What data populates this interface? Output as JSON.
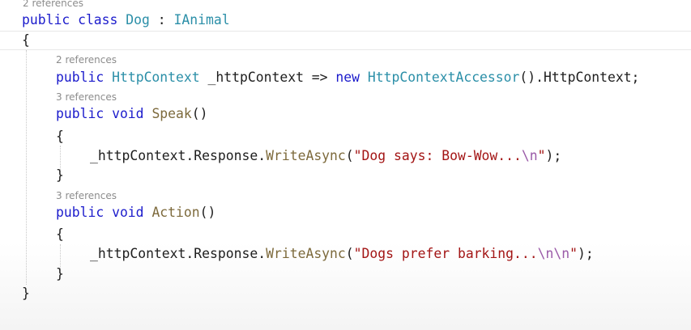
{
  "editor": {
    "refs": {
      "class": "2 references",
      "field": "2 references",
      "speak": "3 references",
      "action": "3 references"
    },
    "line1": {
      "kw": "public class",
      "name": "Dog",
      "sep": " : ",
      "iface": "IAnimal"
    },
    "line2": {
      "text": "{"
    },
    "line3": {
      "kw": "public",
      "type": "HttpContext",
      "mid": " _httpContext => ",
      "kw2": "new",
      "type2": "HttpContextAccessor",
      "tail": "().HttpContext;"
    },
    "line4": {
      "kw": "public void",
      "method": "Speak",
      "tail": "()"
    },
    "line5": {
      "text": "{"
    },
    "line6": {
      "pre": "_httpContext.Response.",
      "method": "WriteAsync",
      "open": "(",
      "str": "\"Dog says: Bow-Wow...",
      "esc": "\\n",
      "strEnd": "\"",
      "close": ");"
    },
    "line7": {
      "text": "}"
    },
    "line8": {
      "kw": "public void",
      "method": "Action",
      "tail": "()"
    },
    "line9": {
      "text": "{"
    },
    "line10": {
      "pre": "_httpContext.Response.",
      "method": "WriteAsync",
      "open": "(",
      "str": "\"Dogs prefer barking...",
      "esc": "\\n\\n",
      "strEnd": "\"",
      "close": ");"
    },
    "line11": {
      "text": "}"
    },
    "line12": {
      "text": "}"
    }
  },
  "colors": {
    "keyword": "#1c1ccc",
    "type": "#2b8fa8",
    "method": "#7d6a3c",
    "string": "#a31515",
    "escape": "#9a5aa8",
    "codelens": "#8c8c8c"
  }
}
